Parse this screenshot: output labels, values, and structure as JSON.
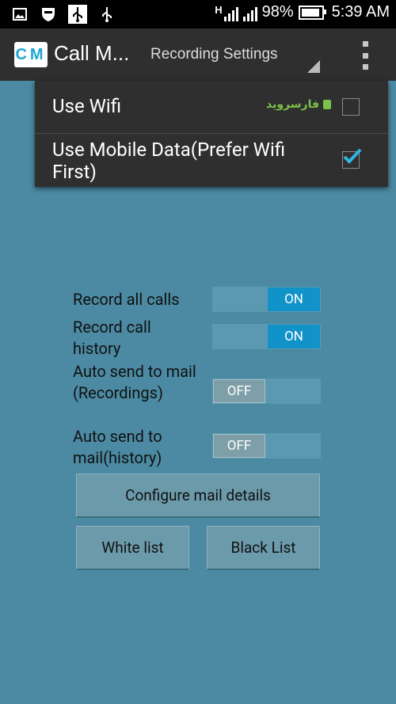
{
  "status_bar": {
    "icons_left": [
      "image-icon",
      "shield-icon",
      "usb-icon",
      "usb-icon"
    ],
    "signal_note": "H",
    "battery_percent": "98%",
    "time": "5:39 AM"
  },
  "action_bar": {
    "logo_text": "CM",
    "app_title": "Call M...",
    "nav_spinner": "Recording Settings"
  },
  "popup": {
    "items": [
      {
        "label": "Use Wifi",
        "checked": false
      },
      {
        "label": "Use Mobile Data(Prefer Wifi First)",
        "checked": true
      }
    ],
    "watermark": "فارسروید"
  },
  "settings": [
    {
      "label": "Record all calls",
      "state": "ON"
    },
    {
      "label": "Record call history",
      "state": "ON"
    },
    {
      "label": "Auto send to mail(Recordings)",
      "state": "OFF"
    },
    {
      "label": "Auto send to mail(history)",
      "state": "OFF"
    }
  ],
  "buttons": {
    "configure": "Configure mail details",
    "white_list": "White list",
    "black_list": "Black List"
  },
  "colors": {
    "background": "#4b8aa2",
    "toggle_on": "#1192c9",
    "check_accent": "#33b5e5"
  }
}
